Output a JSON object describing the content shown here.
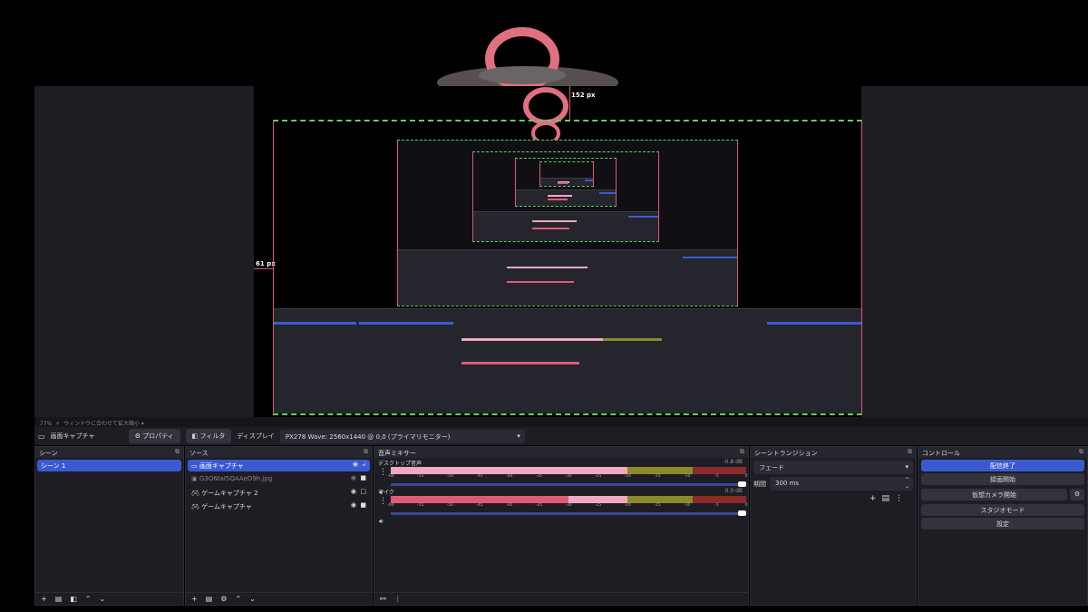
{
  "preview": {
    "measure_top": "152 px",
    "measure_left": "61 px"
  },
  "status": {
    "zoom": "77%",
    "scale_label": "ウィンドウに合わせて拡大縮小"
  },
  "toolbar": {
    "source_name": "画面キャプチャ",
    "properties": "プロパティ",
    "filters": "フィルタ",
    "display_label": "ディスプレイ",
    "display_value": "PX278 Wave: 2560x1440 @ 0,0 (プライマリモニター)"
  },
  "scenes": {
    "title": "シーン",
    "items": [
      "シーン 1"
    ]
  },
  "sources": {
    "title": "ソース",
    "items": [
      "画面キャプチャ",
      "G3ONIaI5QAAeD9h.jpg",
      "ゲームキャプチャ 2",
      "ゲームキャプチャ"
    ]
  },
  "mixer": {
    "title": "音声ミキサー",
    "ticks": [
      "-60",
      "-55",
      "-50",
      "-45",
      "-40",
      "-35",
      "-30",
      "-25",
      "-20",
      "-15",
      "-10",
      "-5",
      "0"
    ],
    "channels": [
      {
        "name": "デスクトップ音声",
        "db": "-0.8 dB",
        "volume": 1.0,
        "level_db": -20
      },
      {
        "name": "マイク",
        "db": "0.0 dB",
        "volume": 1.0,
        "level_db": -20
      }
    ]
  },
  "transitions": {
    "title": "シーントランジション",
    "type": "フェード",
    "duration_label": "期間",
    "duration": "300 ms"
  },
  "controls": {
    "title": "コントロール",
    "buttons": [
      "配信終了",
      "録画開始",
      "仮想カメラ開始",
      "スタジオモード",
      "設定"
    ]
  }
}
